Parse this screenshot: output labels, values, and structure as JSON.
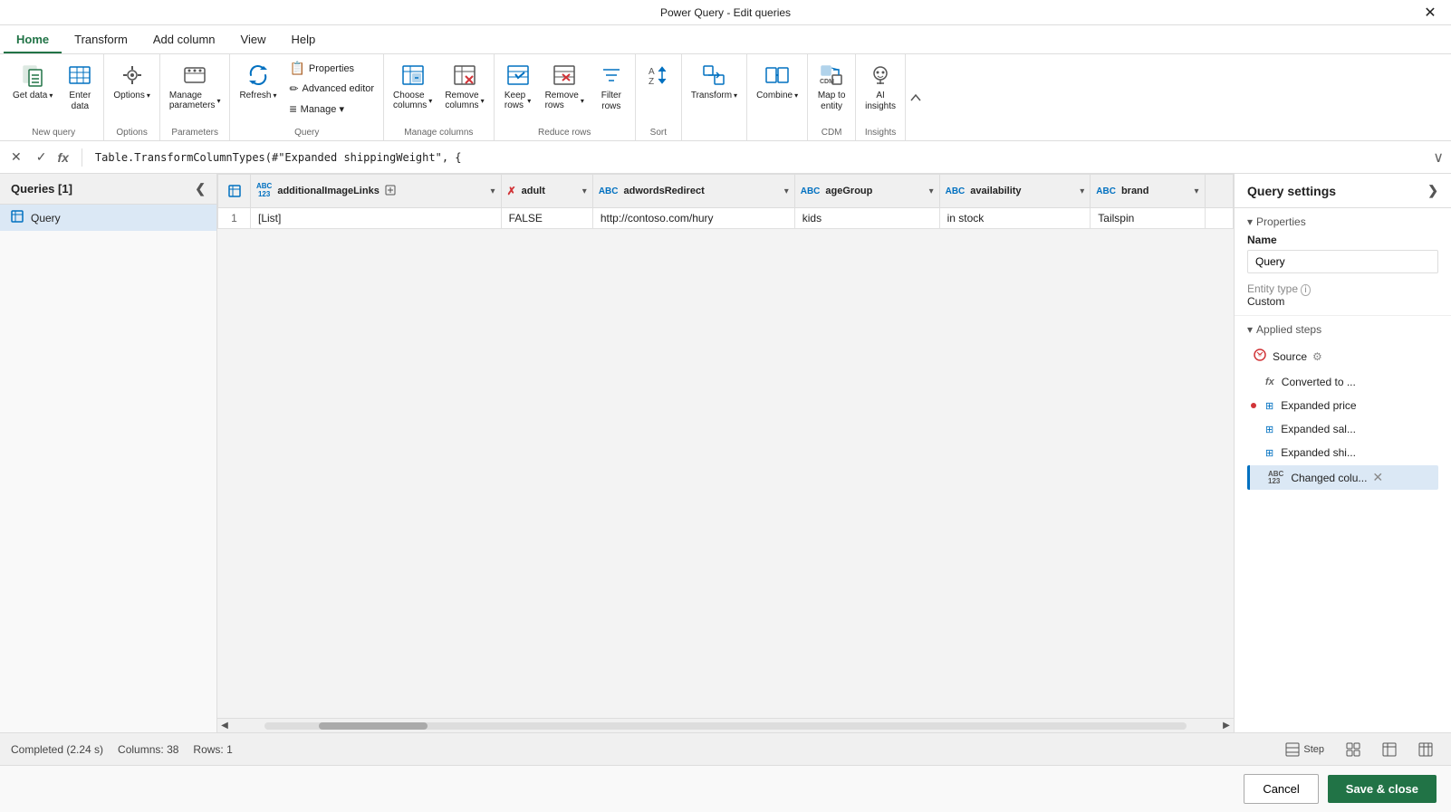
{
  "window": {
    "title": "Power Query - Edit queries",
    "close_label": "✕"
  },
  "ribbon_tabs": [
    {
      "id": "home",
      "label": "Home",
      "active": true
    },
    {
      "id": "transform",
      "label": "Transform"
    },
    {
      "id": "add_column",
      "label": "Add column"
    },
    {
      "id": "view",
      "label": "View"
    },
    {
      "id": "help",
      "label": "Help"
    }
  ],
  "ribbon_groups": [
    {
      "id": "new_query",
      "label": "New query",
      "buttons": [
        {
          "id": "get-data",
          "icon": "📥",
          "label": "Get\ndata",
          "has_arrow": true
        },
        {
          "id": "enter-data",
          "icon": "⊞",
          "label": "Enter\ndata"
        }
      ]
    },
    {
      "id": "options_group",
      "label": "Options",
      "buttons": [
        {
          "id": "options-btn",
          "icon": "⚙",
          "label": "Options",
          "has_arrow": true
        }
      ]
    },
    {
      "id": "parameters",
      "label": "Parameters",
      "buttons": [
        {
          "id": "manage-parameters",
          "icon": "≡",
          "label": "Manage\nparameters",
          "has_arrow": true
        }
      ]
    },
    {
      "id": "query_group",
      "label": "Query",
      "small_buttons": [
        {
          "id": "properties",
          "icon": "📋",
          "label": "Properties"
        },
        {
          "id": "advanced-editor",
          "icon": "✏",
          "label": "Advanced editor"
        },
        {
          "id": "manage",
          "icon": "≡",
          "label": "Manage ▾"
        }
      ],
      "buttons": [
        {
          "id": "refresh",
          "icon": "🔄",
          "label": "Refresh",
          "has_arrow": true
        }
      ]
    },
    {
      "id": "manage_columns",
      "label": "Manage columns",
      "buttons": [
        {
          "id": "choose-columns",
          "icon": "⊞",
          "label": "Choose\ncolumns",
          "has_arrow": true
        },
        {
          "id": "remove-columns",
          "icon": "✗⊞",
          "label": "Remove\ncolumns",
          "has_arrow": true
        }
      ]
    },
    {
      "id": "reduce_rows",
      "label": "Reduce rows",
      "buttons": [
        {
          "id": "keep-rows",
          "icon": "↓⊞",
          "label": "Keep\nrows",
          "has_arrow": true
        },
        {
          "id": "remove-rows",
          "icon": "✗↓",
          "label": "Remove\nrows",
          "has_arrow": true
        },
        {
          "id": "filter-rows",
          "icon": "▽",
          "label": "Filter\nrows"
        }
      ]
    },
    {
      "id": "sort_group",
      "label": "Sort",
      "buttons": [
        {
          "id": "sort-asc",
          "icon": "↑↓",
          "label": ""
        }
      ]
    },
    {
      "id": "transform_group",
      "label": "",
      "buttons": [
        {
          "id": "transform-btn",
          "icon": "⇄",
          "label": "Transform",
          "has_arrow": true
        }
      ]
    },
    {
      "id": "combine_group",
      "label": "",
      "buttons": [
        {
          "id": "combine-btn",
          "icon": "⊞⊞",
          "label": "Combine",
          "has_arrow": true
        }
      ]
    },
    {
      "id": "cdm_group",
      "label": "CDM",
      "buttons": [
        {
          "id": "map-to-entity",
          "icon": "⊞↗",
          "label": "Map to\nentity"
        }
      ]
    },
    {
      "id": "insights_group",
      "label": "Insights",
      "buttons": [
        {
          "id": "ai-insights",
          "icon": "🧠",
          "label": "AI\ninsights"
        }
      ]
    }
  ],
  "formula_bar": {
    "nav_prev": "✕",
    "nav_next": "✓",
    "fx_label": "fx",
    "formula": "Table.TransformColumnTypes(#\"Expanded shippingWeight\", {",
    "expand_icon": "∨"
  },
  "queries_panel": {
    "header": "Queries [1]",
    "collapse_icon": "❮",
    "items": [
      {
        "id": "query1",
        "icon": "⊞",
        "name": "Query"
      }
    ]
  },
  "data_grid": {
    "columns": [
      {
        "id": "additionalImageLinks",
        "type": "ABC\n123",
        "type_label": "ABC\n123",
        "name": "additionalImageLinks",
        "expand_icon": "⊞",
        "has_filter": true
      },
      {
        "id": "adult",
        "type": "✗",
        "type_label": "bool",
        "name": "adult",
        "has_filter": true
      },
      {
        "id": "adwordsRedirect",
        "type": "ABC",
        "type_label": "ABC",
        "name": "adwordsRedirect",
        "has_filter": true
      },
      {
        "id": "ageGroup",
        "type": "ABC",
        "type_label": "ABC",
        "name": "ageGroup",
        "has_filter": true
      },
      {
        "id": "availability",
        "type": "ABC",
        "type_label": "ABC",
        "name": "availability",
        "has_filter": true
      },
      {
        "id": "brand",
        "type": "ABC",
        "type_label": "ABC",
        "name": "brand",
        "has_filter": true
      }
    ],
    "rows": [
      {
        "num": 1,
        "additionalImageLinks": "[List]",
        "adult": "FALSE",
        "adwordsRedirect": "http://contoso.com/hury",
        "ageGroup": "kids",
        "availability": "in stock",
        "brand": "Tailspin"
      }
    ]
  },
  "settings_panel": {
    "header": "Query settings",
    "expand_icon": "❯",
    "properties_section": "Properties",
    "name_label": "Name",
    "name_value": "Query",
    "entity_type_label": "Entity type",
    "entity_type_info": "ℹ",
    "entity_type_value": "Custom",
    "applied_steps_label": "Applied steps",
    "steps": [
      {
        "id": "source",
        "icon": "🔗",
        "label": "Source",
        "has_gear": true,
        "error": false
      },
      {
        "id": "converted",
        "icon": "fx",
        "label": "Converted to ...",
        "has_gear": false,
        "error": false
      },
      {
        "id": "expanded-price",
        "icon": "⊞",
        "label": "Expanded price",
        "has_gear": false,
        "error": true
      },
      {
        "id": "expanded-sal",
        "icon": "⊞",
        "label": "Expanded sal...",
        "has_gear": false,
        "error": false
      },
      {
        "id": "expanded-shi",
        "icon": "⊞",
        "label": "Expanded shi...",
        "has_gear": false,
        "error": false
      },
      {
        "id": "changed-colu",
        "icon": "ABC\n123",
        "label": "Changed colu...",
        "has_gear": false,
        "error": false,
        "selected": true,
        "has_delete": true
      }
    ]
  },
  "status_bar": {
    "status": "Completed (2.24 s)",
    "columns": "Columns: 38",
    "rows": "Rows: 1",
    "step_label": "Step",
    "step_icon": "⊞",
    "table_icon": "⊞",
    "grid_icon": "⊞"
  },
  "bottom_bar": {
    "cancel_label": "Cancel",
    "save_label": "Save & close"
  }
}
